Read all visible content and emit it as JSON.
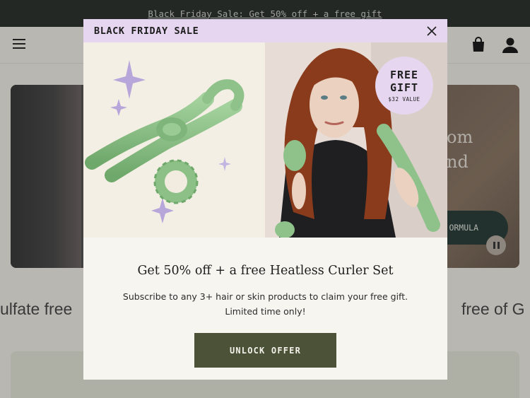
{
  "announcement": {
    "text": "Black Friday Sale: Get 50% off + a free gift"
  },
  "hero": {
    "line1": "om",
    "line2": "nd",
    "cta_label": "ORMULA"
  },
  "marquee": {
    "left": "ulfate free",
    "right": "free of G"
  },
  "popup": {
    "bar_title": "BLACK FRIDAY SALE",
    "badge_line1": "FREE",
    "badge_line2": "GIFT",
    "badge_value": "$32 VALUE",
    "headline": "Get 50% off + a free Heatless Curler Set",
    "subtext_line1": "Subscribe to any 3+ hair or skin products to claim your free gift.",
    "subtext_line2": "Limited time only!",
    "cta_label": "UNLOCK OFFER"
  },
  "colors": {
    "announcement_bg": "#2e3430",
    "popup_bar": "#e6d6f0",
    "cta_bg": "#4c5237",
    "curler_green": "#8fc18a"
  },
  "icons": [
    "hamburger-menu-icon",
    "shopping-bag-icon",
    "account-icon",
    "close-icon",
    "pause-icon",
    "sparkle-icon"
  ]
}
